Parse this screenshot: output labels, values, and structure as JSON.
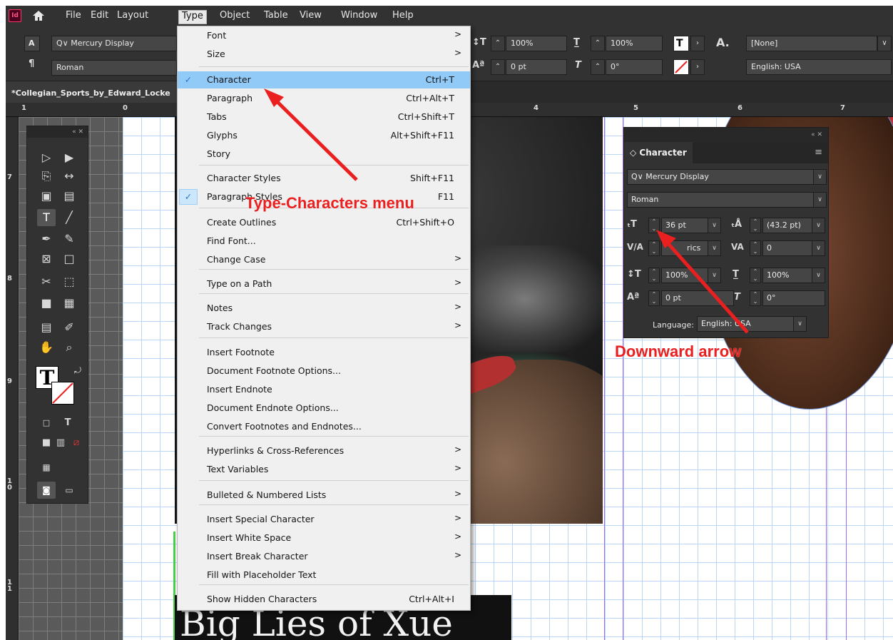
{
  "menubar": {
    "app_logo": "Id",
    "items": [
      "File",
      "Edit",
      "Layout",
      "Type",
      "Object",
      "Table",
      "View",
      "Window",
      "Help"
    ]
  },
  "control": {
    "font_family": "Mercury Display",
    "font_style": "Roman",
    "leading_scale_v": "100%",
    "leading_scale_h": "100%",
    "baseline": "0 pt",
    "skew": "0°",
    "char_style": "[None]",
    "language": "English: USA"
  },
  "document_tab": "*Collegian_Sports_by_Edward_Locke",
  "ruler_h": [
    "1",
    "0",
    "4",
    "5",
    "6",
    "7"
  ],
  "ruler_v": [
    "7",
    "8",
    "9",
    "1\n0",
    "1\n1"
  ],
  "type_menu": {
    "items": [
      {
        "label": "Font",
        "shortcut": "",
        "submenu": true
      },
      {
        "label": "Size",
        "shortcut": "",
        "submenu": true
      },
      {
        "label": "Character",
        "shortcut": "Ctrl+T",
        "checked": true,
        "highlight": true
      },
      {
        "label": "Paragraph",
        "shortcut": "Ctrl+Alt+T"
      },
      {
        "label": "Tabs",
        "shortcut": "Ctrl+Shift+T"
      },
      {
        "label": "Glyphs",
        "shortcut": "Alt+Shift+F11"
      },
      {
        "label": "Story",
        "shortcut": ""
      },
      {
        "label": "Character Styles",
        "shortcut": "Shift+F11"
      },
      {
        "label": "Paragraph Styles",
        "shortcut": "F11",
        "checked": true
      },
      {
        "label": "Create Outlines",
        "shortcut": "Ctrl+Shift+O"
      },
      {
        "label": "Find Font...",
        "shortcut": ""
      },
      {
        "label": "Change Case",
        "shortcut": "",
        "submenu": true
      },
      {
        "label": "Type on a Path",
        "shortcut": "",
        "submenu": true
      },
      {
        "label": "Notes",
        "shortcut": "",
        "submenu": true
      },
      {
        "label": "Track Changes",
        "shortcut": "",
        "submenu": true
      },
      {
        "label": "Insert Footnote",
        "shortcut": ""
      },
      {
        "label": "Document Footnote Options...",
        "shortcut": ""
      },
      {
        "label": "Insert Endnote",
        "shortcut": ""
      },
      {
        "label": "Document Endnote Options...",
        "shortcut": ""
      },
      {
        "label": "Convert Footnotes and Endnotes...",
        "shortcut": ""
      },
      {
        "label": "Hyperlinks & Cross-References",
        "shortcut": "",
        "submenu": true
      },
      {
        "label": "Text Variables",
        "shortcut": "",
        "submenu": true
      },
      {
        "label": "Bulleted & Numbered Lists",
        "shortcut": "",
        "submenu": true
      },
      {
        "label": "Insert Special Character",
        "shortcut": "",
        "submenu": true
      },
      {
        "label": "Insert White Space",
        "shortcut": "",
        "submenu": true
      },
      {
        "label": "Insert Break Character",
        "shortcut": "",
        "submenu": true
      },
      {
        "label": "Fill with Placeholder Text",
        "shortcut": ""
      },
      {
        "label": "Show Hidden Characters",
        "shortcut": "Ctrl+Alt+I"
      }
    ],
    "submenu_arrow": ">",
    "check_mark": "✓"
  },
  "character_panel": {
    "title": "Character",
    "font_family": "Mercury Display",
    "font_style": "Roman",
    "size": "36 pt",
    "leading": "(43.2 pt)",
    "kerning": "Metrics",
    "kerning_visible": "rics",
    "tracking": "0",
    "vscale": "100%",
    "hscale": "100%",
    "baseline": "0 pt",
    "skew": "0°",
    "language_label": "Language:",
    "language": "English: USA"
  },
  "canvas": {
    "headline": "Big Lies of Xue"
  },
  "annotations": {
    "menu_note": "Type-Characters menu",
    "arrow_note": "Downward arrow"
  },
  "colors": {
    "annotation": "#ea1f1f",
    "menu_highlight": "#91c9f7",
    "guide": "#9b6cf5"
  }
}
